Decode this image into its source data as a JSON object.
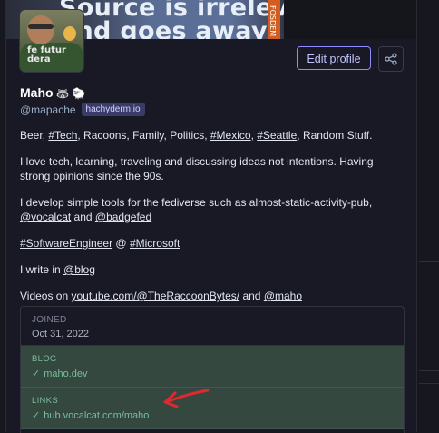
{
  "banner": {
    "text": "Source is irrelevant\nand goes away",
    "side_label": "FOSDEM"
  },
  "profile": {
    "display_name": "Maho",
    "emoji": "🦝 🐑",
    "handle": "@mapache",
    "server_badge": "hachyderm.io",
    "edit_label": "Edit profile"
  },
  "bio": {
    "p1": {
      "a": "Beer, ",
      "tag_tech": "#Tech",
      "b": ", Racoons, Family, Politics, ",
      "tag_mexico": "#Mexico",
      "c": ", ",
      "tag_seattle": "#Seattle",
      "d": ", Random Stuff."
    },
    "p2": "I love tech, learning, traveling and discussing ideas not intentions. Having strong opinions since the 90s.",
    "p3": {
      "a": "I develop simple tools for the fediverse such as almost-static-activity-pub, ",
      "link_vocalcat": "@vocalcat",
      "b": " and ",
      "link_badgefed": "@badgefed"
    },
    "p4": {
      "tag_se": "#SoftwareEngineer",
      "a": " @ ",
      "tag_ms": "#Microsoft"
    },
    "p5": {
      "a": "I write in ",
      "link_blog": "@blog"
    },
    "p6": {
      "a": "Videos on ",
      "link_yt": "youtube.com/@TheRaccoonBytes/",
      "b": " and ",
      "link_maho": "@maho"
    }
  },
  "fields": {
    "joined_label": "JOINED",
    "joined_value": "Oct 31, 2022",
    "blog_label": "BLOG",
    "blog_value": "maho.dev",
    "links_label": "LINKS",
    "links_value": "hub.vocalcat.com/maho"
  },
  "colors": {
    "accent": "#8c8dff",
    "verified": "#79bd9a",
    "annotation_arrow": "#e0282e"
  },
  "icons": {
    "share": "share-icon",
    "check": "check-icon",
    "annotation": "red-arrow-annotation"
  }
}
